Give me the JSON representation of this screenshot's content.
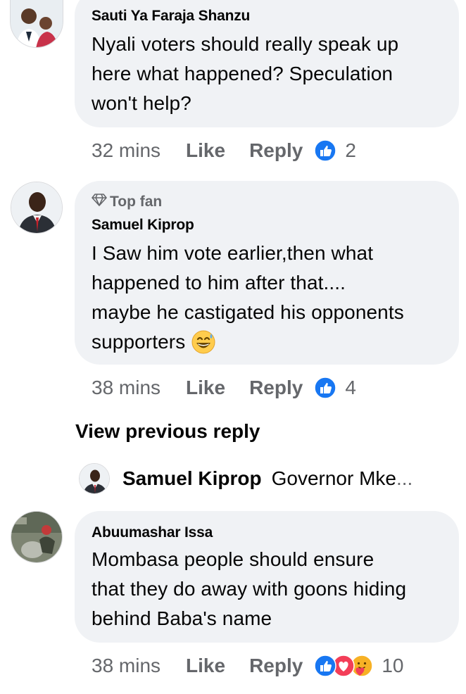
{
  "comments": [
    {
      "author": "Sauti Ya Faraja Shanzu",
      "text_lines": [
        "Nyali voters should really speak up",
        "here what happened? Speculation",
        "won't help?"
      ],
      "time": "32 mins",
      "like_label": "Like",
      "reply_label": "Reply",
      "reaction_count": "2",
      "reactions": [
        "like-icon"
      ]
    },
    {
      "badge": "Top fan",
      "author": "Samuel Kiprop",
      "text_lines": [
        "I Saw him vote earlier,then what",
        "happened to him after that....",
        "maybe he castigated his opponents",
        "supporters"
      ],
      "emoji": "grinning-sweat-emoji",
      "time": "38 mins",
      "like_label": "Like",
      "reply_label": "Reply",
      "reaction_count": "4",
      "reactions": [
        "like-icon"
      ]
    },
    {
      "author": "Abuumashar Issa",
      "text_lines": [
        "Mombasa people should ensure",
        "that they do away with goons hiding",
        "behind Baba's name"
      ],
      "time": "38 mins",
      "like_label": "Like",
      "reply_label": "Reply",
      "reaction_count": "10",
      "reactions": [
        "like-icon",
        "love-icon",
        "care-icon"
      ]
    }
  ],
  "view_previous_reply": "View previous reply",
  "reply_preview": {
    "author": "Samuel Kiprop",
    "text": "Governor Mke",
    "ellipsis": "..."
  },
  "colors": {
    "bubble": "#f0f2f5",
    "secondary_text": "#65676b",
    "like_blue": "#1877f2",
    "love_red": "#f33e58",
    "care_yellow": "#f7b125"
  }
}
